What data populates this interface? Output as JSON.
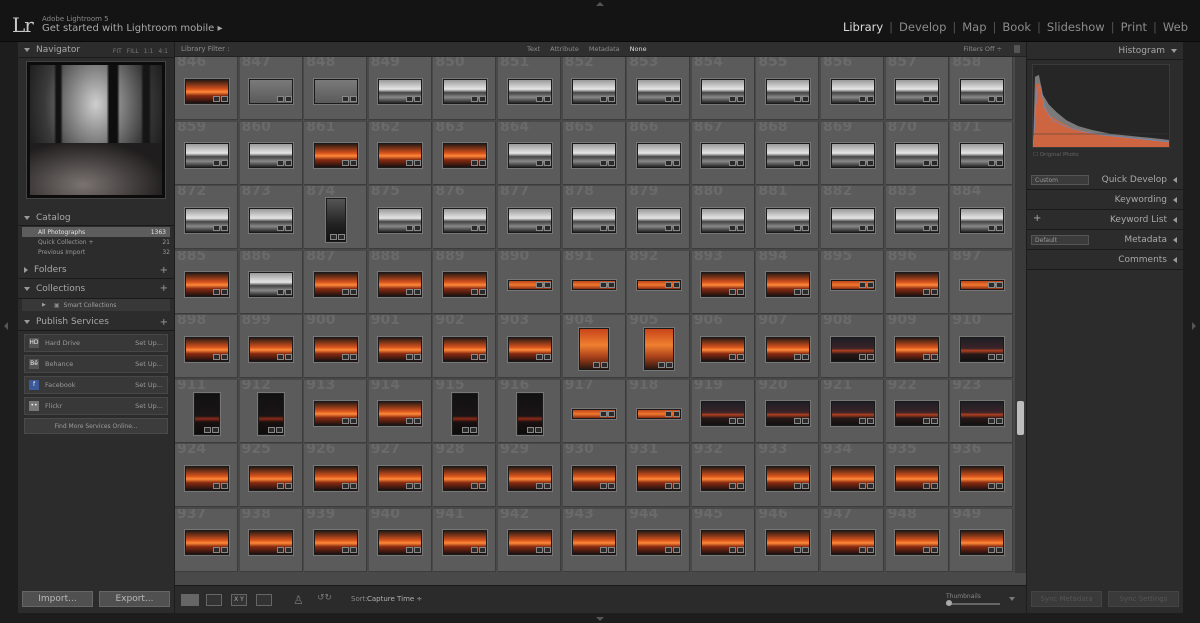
{
  "app": {
    "product": "Adobe Lightroom 5",
    "logo": "Lr",
    "mobile_prompt": "Get started with Lightroom mobile"
  },
  "modules": [
    {
      "label": "Library",
      "active": true
    },
    {
      "label": "Develop"
    },
    {
      "label": "Map"
    },
    {
      "label": "Book"
    },
    {
      "label": "Slideshow"
    },
    {
      "label": "Print"
    },
    {
      "label": "Web"
    }
  ],
  "navigator": {
    "title": "Navigator",
    "options": [
      "FIT",
      "FILL",
      "1:1",
      "4:1"
    ]
  },
  "catalog": {
    "title": "Catalog",
    "items": [
      {
        "label": "All Photographs",
        "count": "1363",
        "selected": true
      },
      {
        "label": "Quick Collection +",
        "count": "21"
      },
      {
        "label": "Previous Import",
        "count": "32"
      }
    ]
  },
  "folders": {
    "title": "Folders"
  },
  "collections": {
    "title": "Collections",
    "items": [
      {
        "label": "Smart Collections"
      }
    ]
  },
  "publish": {
    "title": "Publish Services",
    "services": [
      {
        "label": "Hard Drive",
        "action": "Set Up...",
        "icon": "hard-drive-icon",
        "glyph": "HD",
        "color": "#555"
      },
      {
        "label": "Behance",
        "action": "Set Up...",
        "icon": "behance-icon",
        "glyph": "Bē",
        "color": "#555"
      },
      {
        "label": "Facebook",
        "action": "Set Up...",
        "icon": "facebook-icon",
        "glyph": "f",
        "color": "#3b5998"
      },
      {
        "label": "Flickr",
        "action": "Set Up...",
        "icon": "flickr-icon",
        "glyph": "••",
        "color": "#777"
      }
    ],
    "find_more": "Find More Services Online..."
  },
  "left_buttons": {
    "import": "Import...",
    "export": "Export..."
  },
  "library_filter": {
    "label": "Library Filter :",
    "options": [
      {
        "label": "Text"
      },
      {
        "label": "Attribute"
      },
      {
        "label": "Metadata"
      },
      {
        "label": "None",
        "selected": true
      }
    ],
    "filters_off": "Filters Off ÷"
  },
  "grid": {
    "rows": [
      {
        "start": 846,
        "kinds": [
          "o",
          "g",
          "g",
          "s",
          "s",
          "s",
          "s",
          "s",
          "s",
          "s",
          "s",
          "s",
          "s"
        ]
      },
      {
        "start": 859,
        "kinds": [
          "s",
          "s",
          "o",
          "o",
          "o",
          "s",
          "s",
          "s",
          "s",
          "s",
          "s",
          "s",
          "s"
        ]
      },
      {
        "start": 872,
        "kinds": [
          "s",
          "s",
          "v",
          "s",
          "s",
          "s",
          "s",
          "s",
          "s",
          "s",
          "s",
          "s",
          "s"
        ]
      },
      {
        "start": 885,
        "kinds": [
          "o",
          "s",
          "o",
          "o",
          "o",
          "t",
          "t",
          "t",
          "o",
          "o",
          "t",
          "o",
          "t"
        ]
      },
      {
        "start": 898,
        "kinds": [
          "o",
          "o",
          "o",
          "o",
          "o",
          "o",
          "vo",
          "vo",
          "o",
          "o",
          "d",
          "o",
          "d"
        ]
      },
      {
        "start": 911,
        "kinds": [
          "vd",
          "vd",
          "o",
          "o",
          "vd",
          "vd",
          "t",
          "t",
          "d",
          "d",
          "d",
          "d",
          "d"
        ]
      },
      {
        "start": 924,
        "kinds": [
          "o",
          "o",
          "o",
          "o",
          "o",
          "o",
          "o",
          "o",
          "o",
          "o",
          "o",
          "o",
          "o"
        ]
      },
      {
        "start": 937,
        "kinds": [
          "o",
          "o",
          "o",
          "o",
          "o",
          "o",
          "o",
          "o",
          "o",
          "o",
          "o",
          "o",
          "o"
        ]
      }
    ]
  },
  "toolbar": {
    "sort_label": "Sort:",
    "sort_value": "Capture Time ÷",
    "thumbnails_label": "Thumbnails"
  },
  "right_panel": {
    "histogram": "Histogram",
    "original_photo": "Original Photo",
    "quick_develop": "Quick Develop",
    "quick_preset": "Custom",
    "keywording": "Keywording",
    "keyword_list": "Keyword List",
    "metadata": "Metadata",
    "metadata_preset": "Default",
    "comments": "Comments"
  },
  "right_buttons": {
    "sync_metadata": "Sync Metadata",
    "sync_settings": "Sync Settings"
  }
}
